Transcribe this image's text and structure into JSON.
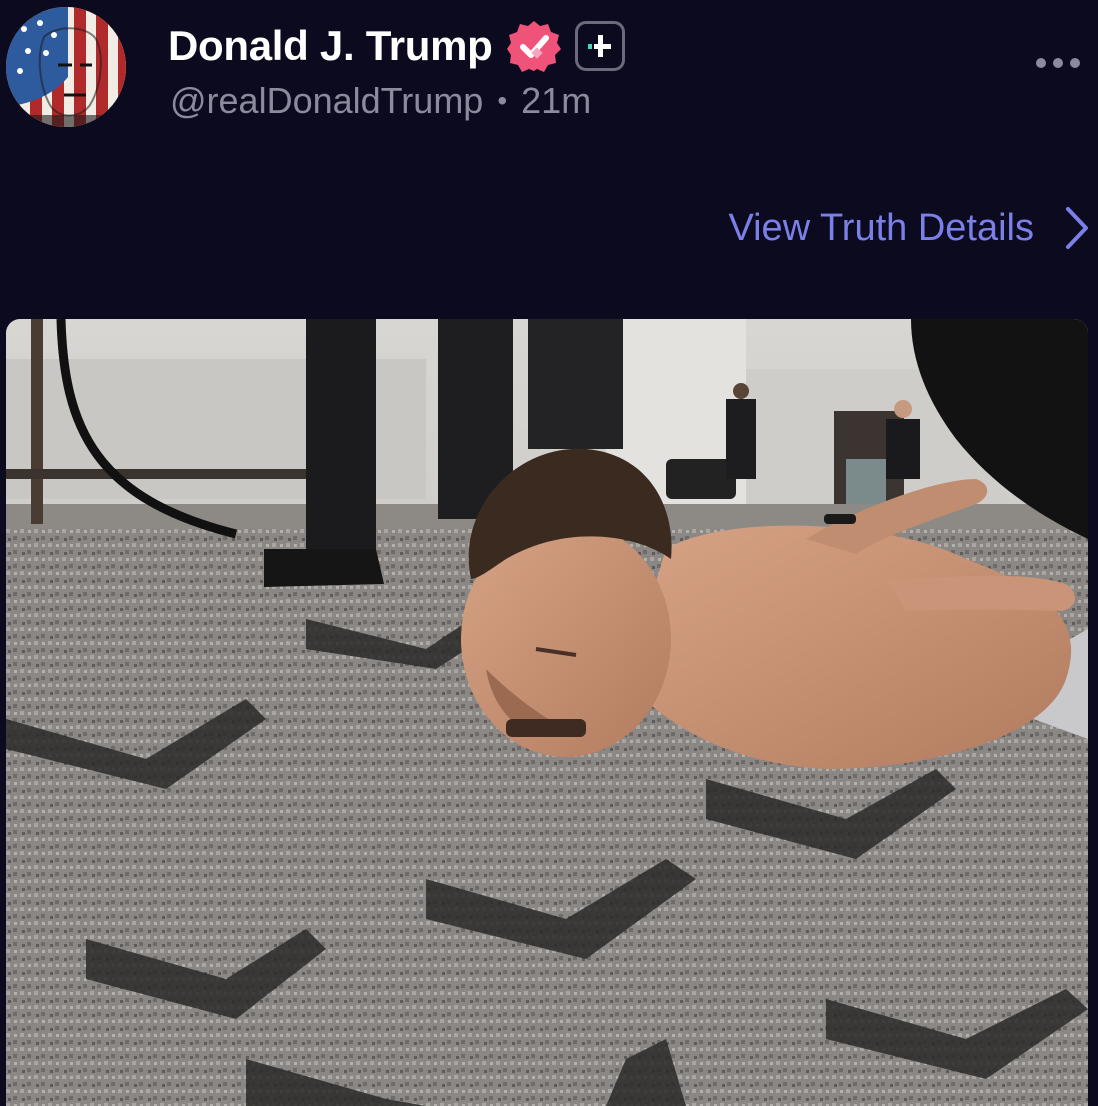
{
  "post": {
    "author": {
      "display_name": "Donald J. Trump",
      "handle": "@realDonaldTrump",
      "avatar_icon": "american-flag-face-avatar",
      "verified_icon": "verified-badge-icon",
      "verified_color": "#f0537a"
    },
    "timestamp": "21m",
    "separator": "•",
    "more_icon": "more-options-icon",
    "details_link": {
      "label": "View Truth Details",
      "icon": "chevron-right-icon"
    },
    "media": {
      "type": "photo"
    }
  },
  "colors": {
    "background": "#0c0a1f",
    "accent": "#7b80e8",
    "muted_text": "#8c8a9c",
    "text": "#ffffff"
  }
}
